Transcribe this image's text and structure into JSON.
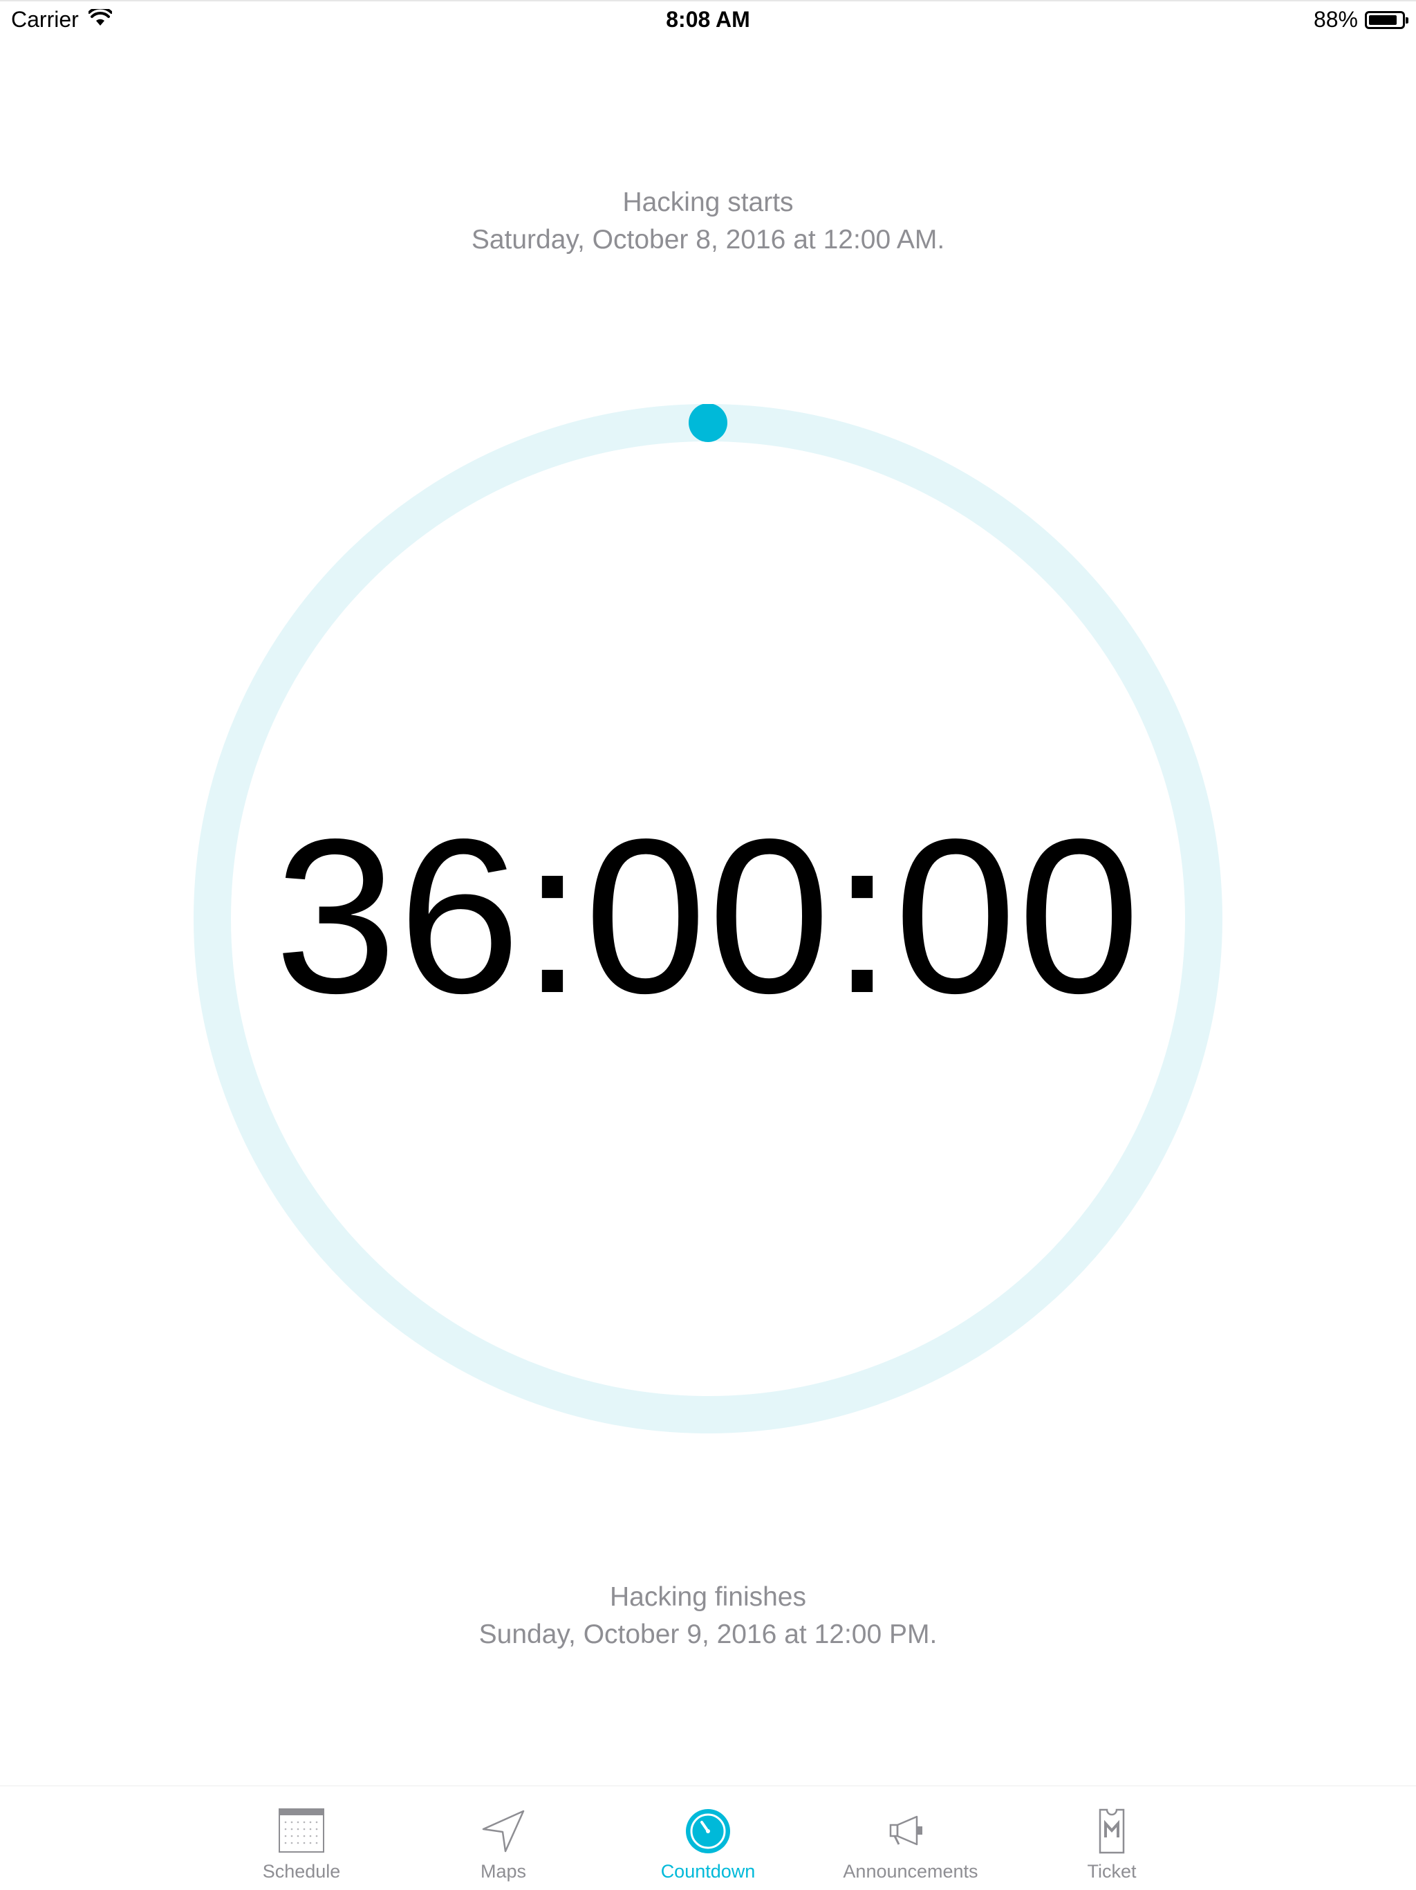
{
  "status_bar": {
    "carrier": "Carrier",
    "time": "8:08 AM",
    "battery_percent": "88%",
    "battery_level": 0.88,
    "wifi_icon": "wifi-icon",
    "battery_icon": "battery-icon"
  },
  "countdown": {
    "start_label": "Hacking starts",
    "start_datetime": "Saturday, October 8, 2016 at 12:00 AM.",
    "remaining": "36:00:00",
    "progress": 0,
    "end_label": "Hacking finishes",
    "end_datetime": "Sunday, October 9, 2016 at 12:00 PM."
  },
  "colors": {
    "accent": "#00b9d9",
    "ring_track": "#e4f6f9",
    "secondary_text": "#8e8e93",
    "inactive_icon": "#8e8e93"
  },
  "tab_bar": {
    "items": [
      {
        "label": "Schedule",
        "icon": "calendar-icon",
        "active": false
      },
      {
        "label": "Maps",
        "icon": "navigation-arrow-icon",
        "active": false
      },
      {
        "label": "Countdown",
        "icon": "timer-icon",
        "active": true
      },
      {
        "label": "Announcements",
        "icon": "megaphone-icon",
        "active": false
      },
      {
        "label": "Ticket",
        "icon": "ticket-icon",
        "active": false
      }
    ]
  }
}
